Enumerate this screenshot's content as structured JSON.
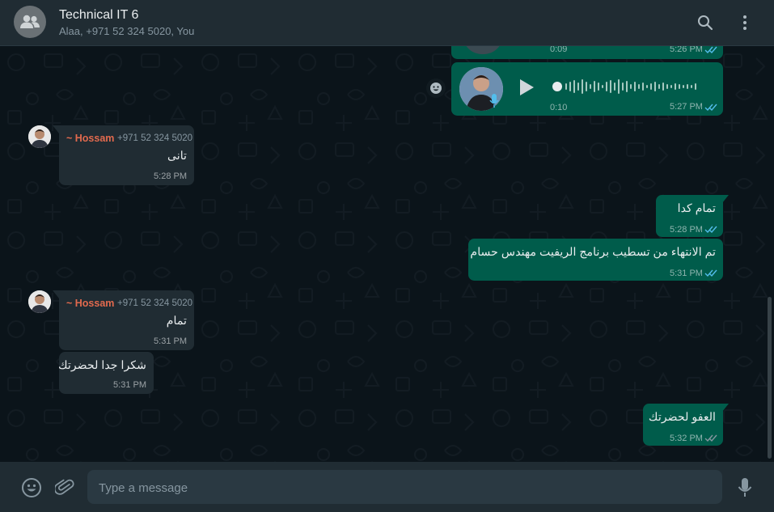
{
  "header": {
    "title": "Technical IT 6",
    "subtitle": "Alaa, +971 52 324 5020, You",
    "search_icon": "search-icon",
    "menu_icon": "menu-icon"
  },
  "messages": {
    "voice1": {
      "duration": "0:09",
      "time": "5:26 PM"
    },
    "voice2": {
      "duration": "0:10",
      "time": "5:27 PM"
    },
    "m1": {
      "sender": "~ Hossam",
      "phone": "+971 52 324 5020",
      "text": "تانى",
      "time": "5:28 PM"
    },
    "m2": {
      "text": "تمام كدا",
      "time": "5:28 PM"
    },
    "m3": {
      "text": "تم الانتهاء من تسطيب برنامج الريفيت مهندس حسام",
      "time": "5:31 PM"
    },
    "m4": {
      "sender": "~ Hossam",
      "phone": "+971 52 324 5020",
      "text": "تمام",
      "time": "5:31 PM"
    },
    "m5": {
      "text": "شكرا جدا لحضرتك",
      "time": "5:31 PM"
    },
    "m6": {
      "text": "العفو لحضرتك",
      "time": "5:32 PM"
    }
  },
  "composer": {
    "placeholder": "Type a message",
    "emoji_icon": "emoji-icon",
    "attach_icon": "attach-icon",
    "mic_icon": "mic-icon"
  },
  "colors": {
    "outgoing_bubble": "#005c4b",
    "incoming_bubble": "#202c33",
    "sender_name": "#e26a4e",
    "read_ticks": "#53bdeb",
    "background": "#0b141a"
  }
}
